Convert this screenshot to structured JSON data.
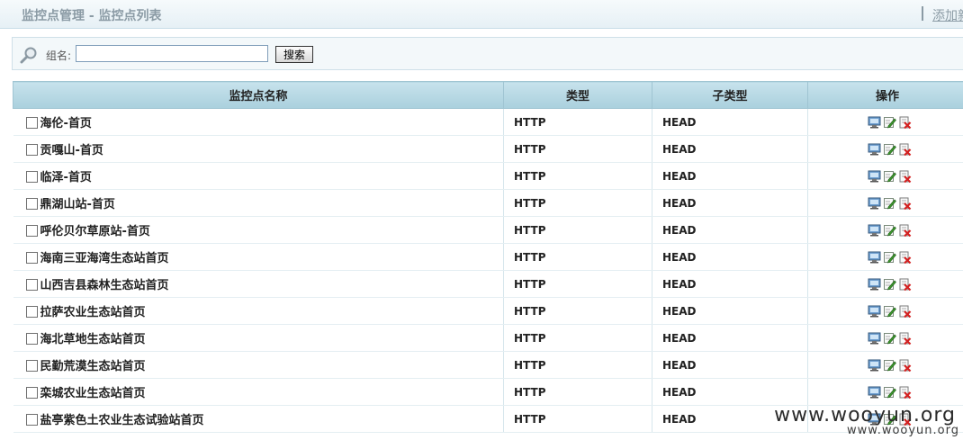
{
  "header": {
    "title": "监控点管理 - 监控点列表",
    "add_link": "添加新"
  },
  "search": {
    "label": "组名:",
    "value": "",
    "button": "搜索"
  },
  "table": {
    "columns": [
      "监控点名称",
      "类型",
      "子类型",
      "操作"
    ],
    "rows": [
      {
        "name": "海伦-首页",
        "type": "HTTP",
        "sub": "HEAD"
      },
      {
        "name": "贡嘎山-首页",
        "type": "HTTP",
        "sub": "HEAD"
      },
      {
        "name": "临泽-首页",
        "type": "HTTP",
        "sub": "HEAD"
      },
      {
        "name": "鼎湖山站-首页",
        "type": "HTTP",
        "sub": "HEAD"
      },
      {
        "name": "呼伦贝尔草原站-首页",
        "type": "HTTP",
        "sub": "HEAD"
      },
      {
        "name": "海南三亚海湾生态站首页",
        "type": "HTTP",
        "sub": "HEAD"
      },
      {
        "name": "山西吉县森林生态站首页",
        "type": "HTTP",
        "sub": "HEAD"
      },
      {
        "name": "拉萨农业生态站首页",
        "type": "HTTP",
        "sub": "HEAD"
      },
      {
        "name": "海北草地生态站首页",
        "type": "HTTP",
        "sub": "HEAD"
      },
      {
        "name": "民勤荒漠生态站首页",
        "type": "HTTP",
        "sub": "HEAD"
      },
      {
        "name": "栾城农业生态站首页",
        "type": "HTTP",
        "sub": "HEAD"
      },
      {
        "name": "盐亭紫色土农业生态试验站首页",
        "type": "HTTP",
        "sub": "HEAD"
      }
    ]
  },
  "icons": {
    "monitor": "monitor-icon",
    "edit": "edit-icon",
    "delete": "delete-icon",
    "search": "magnifier-icon"
  },
  "watermark": {
    "large": "www.wooyun.org",
    "small": "www.wooyun.org"
  }
}
